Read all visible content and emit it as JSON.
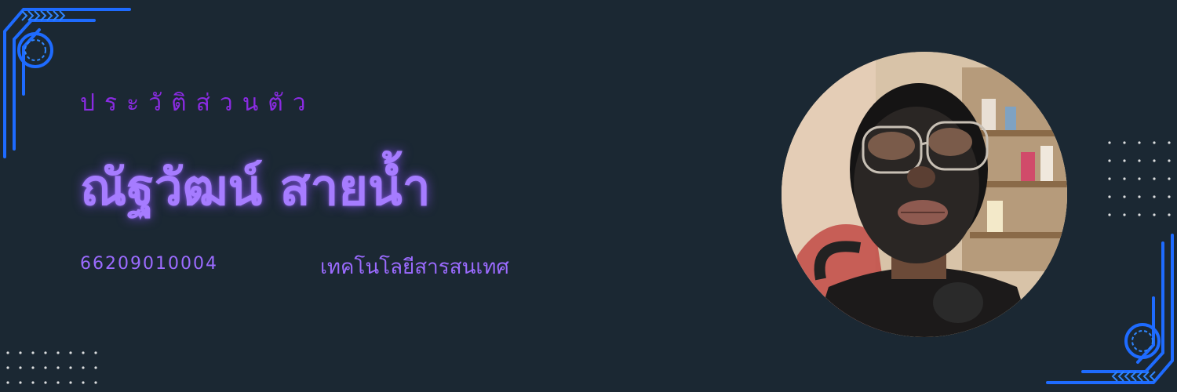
{
  "profile": {
    "section_title": "ประวัติส่วนตัว",
    "name": "ณัฐวัฒน์ สายน้ำ",
    "student_id": "66209010004",
    "major": "เทคโนโลยีสารสนเทศ"
  },
  "colors": {
    "background": "#1b2833",
    "title_purple": "#8a2be2",
    "name_purple": "#a67cff",
    "circuit_blue": "#1e6bff",
    "dots": "#ffffff"
  },
  "decorations": {
    "top_left_icon": "circuit-corner-icon",
    "bottom_right_icon": "circuit-corner-icon",
    "dot_grids": "dot-grid-icon",
    "photo": "profile-photo"
  }
}
